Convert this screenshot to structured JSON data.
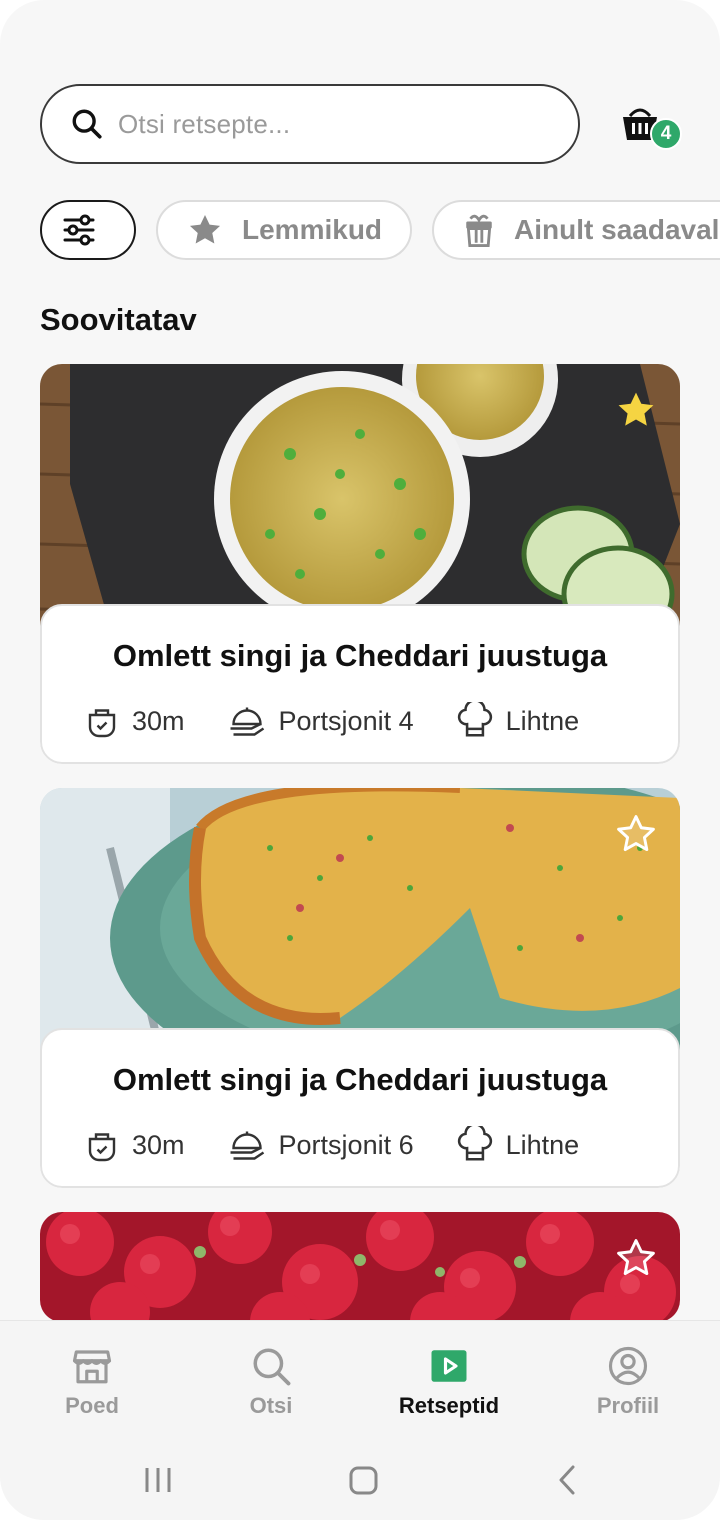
{
  "search": {
    "placeholder": "Otsi retsepte..."
  },
  "basket": {
    "count": "4"
  },
  "filters": [
    {
      "label": "Lemmikud",
      "icon": "star-icon"
    },
    {
      "label": "Ainult saadaval",
      "icon": "gift-box-icon"
    }
  ],
  "section": {
    "title": "Soovitatav"
  },
  "recipes": [
    {
      "title": "Omlett singi ja Cheddari juustuga",
      "time": "30m",
      "portions": "Portsjonit 4",
      "difficulty": "Lihtne",
      "favorite": true
    },
    {
      "title": "Omlett singi ja Cheddari juustuga",
      "time": "30m",
      "portions": "Portsjonit 6",
      "difficulty": "Lihtne",
      "favorite": false
    },
    {
      "favorite": false
    }
  ],
  "nav": [
    {
      "label": "Poed",
      "icon": "store-icon"
    },
    {
      "label": "Otsi",
      "icon": "search-icon"
    },
    {
      "label": "Retseptid",
      "icon": "play-icon",
      "active": true
    },
    {
      "label": "Profiil",
      "icon": "user-circle-icon"
    }
  ],
  "colors": {
    "accent": "#2fa86a",
    "favorite": "#f5d442",
    "text": "#111111",
    "muted": "#9a9a9a"
  }
}
